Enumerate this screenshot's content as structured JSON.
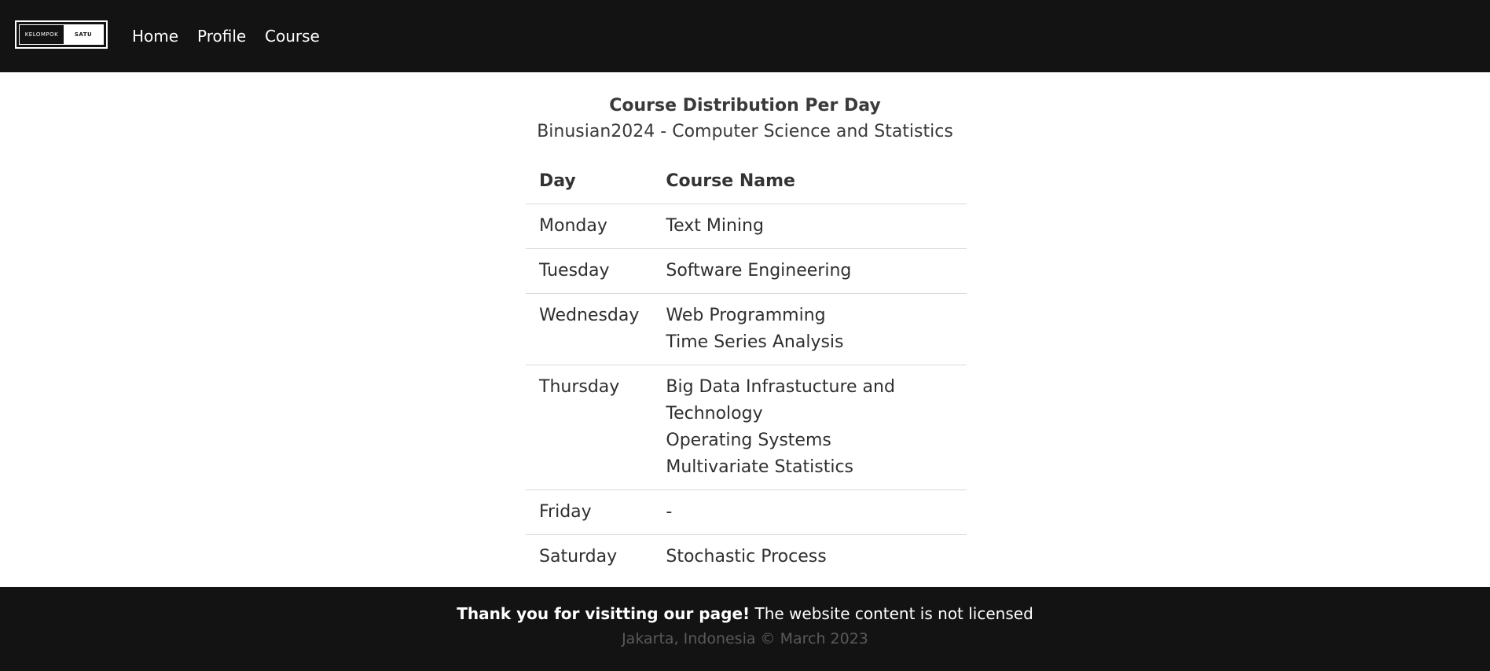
{
  "navbar": {
    "logo": {
      "left_text": "KELOMPOK",
      "right_text": "SATU"
    },
    "links": {
      "home": "Home",
      "profile": "Profile",
      "course": "Course"
    }
  },
  "main": {
    "title": "Course Distribution Per Day",
    "subtitle": "Binusian2024 - Computer Science and Statistics",
    "table": {
      "headers": {
        "day": "Day",
        "course": "Course Name"
      },
      "rows": [
        {
          "day": "Monday",
          "courses": [
            "Text Mining"
          ]
        },
        {
          "day": "Tuesday",
          "courses": [
            "Software Engineering"
          ]
        },
        {
          "day": "Wednesday",
          "courses": [
            "Web Programming",
            "Time Series Analysis"
          ]
        },
        {
          "day": "Thursday",
          "courses": [
            "Big Data Infrastucture and Technology",
            "Operating Systems",
            "Multivariate Statistics"
          ]
        },
        {
          "day": "Friday",
          "courses": [
            "-"
          ]
        },
        {
          "day": "Saturday",
          "courses": [
            "Stochastic Process"
          ]
        }
      ]
    }
  },
  "footer": {
    "bold_text": "Thank you for visitting our page!",
    "text": " The website content is not licensed",
    "copyright": "Jakarta, Indonesia © March 2023"
  },
  "colors": {
    "nav_background": "#131313",
    "footer_background": "#131313",
    "text": "#333333",
    "divider": "#d8d8d8"
  }
}
